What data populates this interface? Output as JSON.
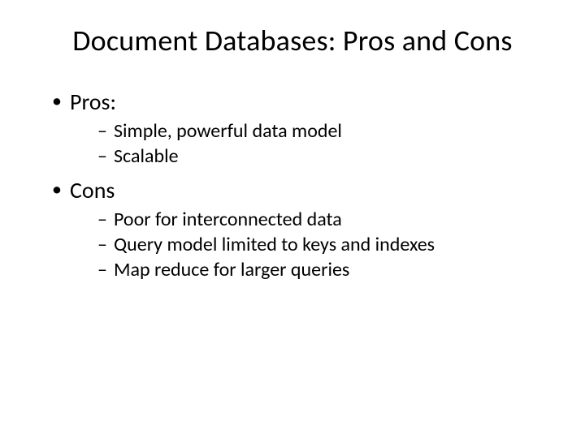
{
  "title": "Document Databases: Pros and Cons",
  "sections": [
    {
      "label": "Pros:",
      "items": [
        "Simple, powerful data model",
        "Scalable"
      ]
    },
    {
      "label": "Cons",
      "items": [
        "Poor for interconnected data",
        "Query model limited to keys and indexes",
        "Map reduce for larger queries"
      ]
    }
  ]
}
